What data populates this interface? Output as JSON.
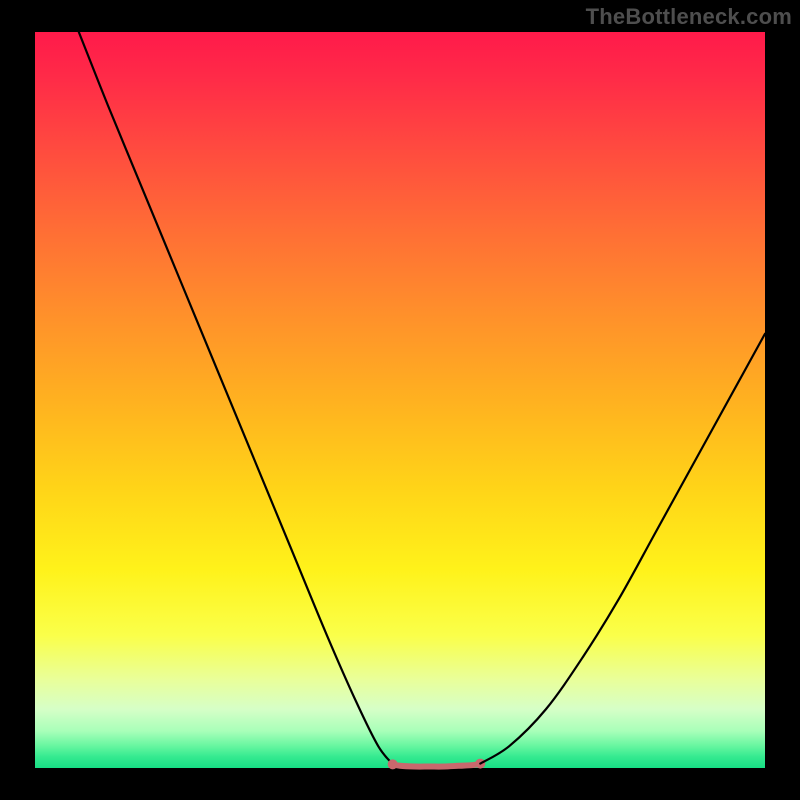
{
  "watermark": "TheBottleneck.com",
  "chart_data": {
    "type": "line",
    "title": "",
    "xlabel": "",
    "ylabel": "",
    "xlim": [
      0,
      100
    ],
    "ylim": [
      0,
      100
    ],
    "grid": false,
    "series": [
      {
        "name": "left-curve",
        "color": "#000000",
        "x": [
          6,
          10,
          15,
          20,
          25,
          30,
          35,
          40,
          44,
          47,
          49
        ],
        "values": [
          100,
          90,
          78,
          66,
          54,
          42,
          30,
          18,
          9,
          3,
          0.5
        ]
      },
      {
        "name": "valley-floor",
        "color": "#c9686d",
        "x": [
          49,
          50,
          52,
          54,
          56,
          58,
          60,
          61
        ],
        "values": [
          0.5,
          0.3,
          0.2,
          0.2,
          0.2,
          0.3,
          0.4,
          0.6
        ]
      },
      {
        "name": "right-curve",
        "color": "#000000",
        "x": [
          61,
          65,
          70,
          75,
          80,
          85,
          90,
          95,
          100
        ],
        "values": [
          0.6,
          3,
          8,
          15,
          23,
          32,
          41,
          50,
          59
        ]
      }
    ],
    "annotations": []
  },
  "colors": {
    "watermark": "#4e4e4e",
    "curve": "#000000",
    "valley_marker": "#c9686d"
  }
}
